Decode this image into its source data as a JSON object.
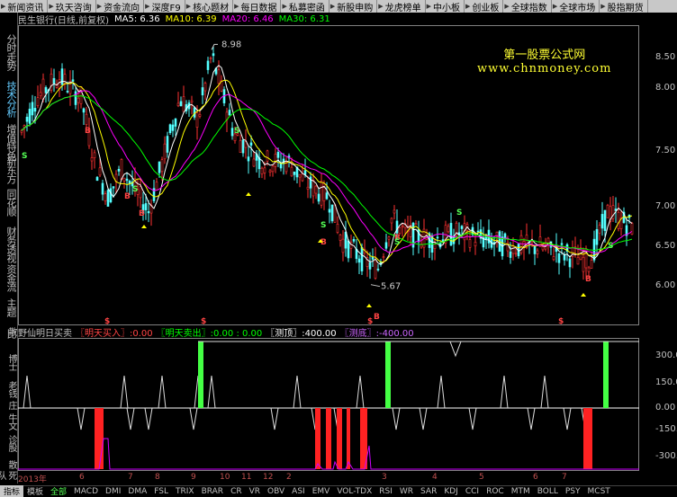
{
  "topbar": {
    "items": [
      "新闻资讯",
      "玖天咨询",
      "资金流向",
      "深度F9",
      "核心题材",
      "每日数据",
      "私募密函",
      "新股申购",
      "龙虎榜单",
      "中小板",
      "创业板",
      "全球指数",
      "全球市场",
      "股指期货"
    ]
  },
  "leftbar": {
    "items": [
      "分时走势",
      "技术分析",
      "增值特色",
      "新东方",
      "同花顺",
      "财务透视",
      "资金流",
      "主题",
      "比"
    ],
    "active_index": 1
  },
  "header": {
    "stock": "民生银行(日线,前复权)",
    "ma5": "MA5: 6.36",
    "ma10": "MA10: 6.39",
    "ma20": "MA20: 6.46",
    "ma30": "MA30: 6.31"
  },
  "colors": {
    "ma5": "#ffffff",
    "ma10": "#ffff00",
    "ma20": "#ff00ff",
    "ma30": "#00ff00",
    "up": "#ff3232",
    "down": "#54ffff"
  },
  "watermark": {
    "line1": "第一股票公式网",
    "line2": "www.chnmoney.com"
  },
  "main_price_annotations": {
    "high": "8.98",
    "low": "5.67"
  },
  "right_axis_main": [
    "8.00",
    "7.50",
    "7.00",
    "6.50",
    "6.00",
    "8.50"
  ],
  "indicator": {
    "name": "野仙明日买卖",
    "buy_label": "明天买入",
    "buy_value": "0.00",
    "sell_label": "明天卖出",
    "sell_value": "0.00 : 0.00",
    "top_label": "测顶",
    "top_value": "400.00",
    "bottom_label": "测底",
    "bottom_value": "-400.00"
  },
  "right_axis_ind": [
    "300.00",
    "150.00",
    "0.00",
    "-150.00",
    "-300.00"
  ],
  "left_labels_ind": [
    "散",
    "博士",
    "老钱",
    "庄",
    "牛文",
    "诊股",
    "散",
    "死队"
  ],
  "xaxis": {
    "year": "2013年",
    "labels": [
      "6",
      "7",
      "8",
      "9",
      "10",
      "11",
      "12",
      "2",
      "3",
      "4",
      "5",
      "6",
      "7"
    ]
  },
  "tabs": [
    "指标",
    "模板",
    "全部",
    "MACD",
    "DMI",
    "DMA",
    "FSL",
    "TRIX",
    "BRAR",
    "CR",
    "VR",
    "OBV",
    "ASI",
    "EMV",
    "VOL-TDX",
    "RSI",
    "WR",
    "SAR",
    "KDJ",
    "CCI",
    "ROC",
    "MTM",
    "BOLL",
    "PSY",
    "MCST"
  ]
}
